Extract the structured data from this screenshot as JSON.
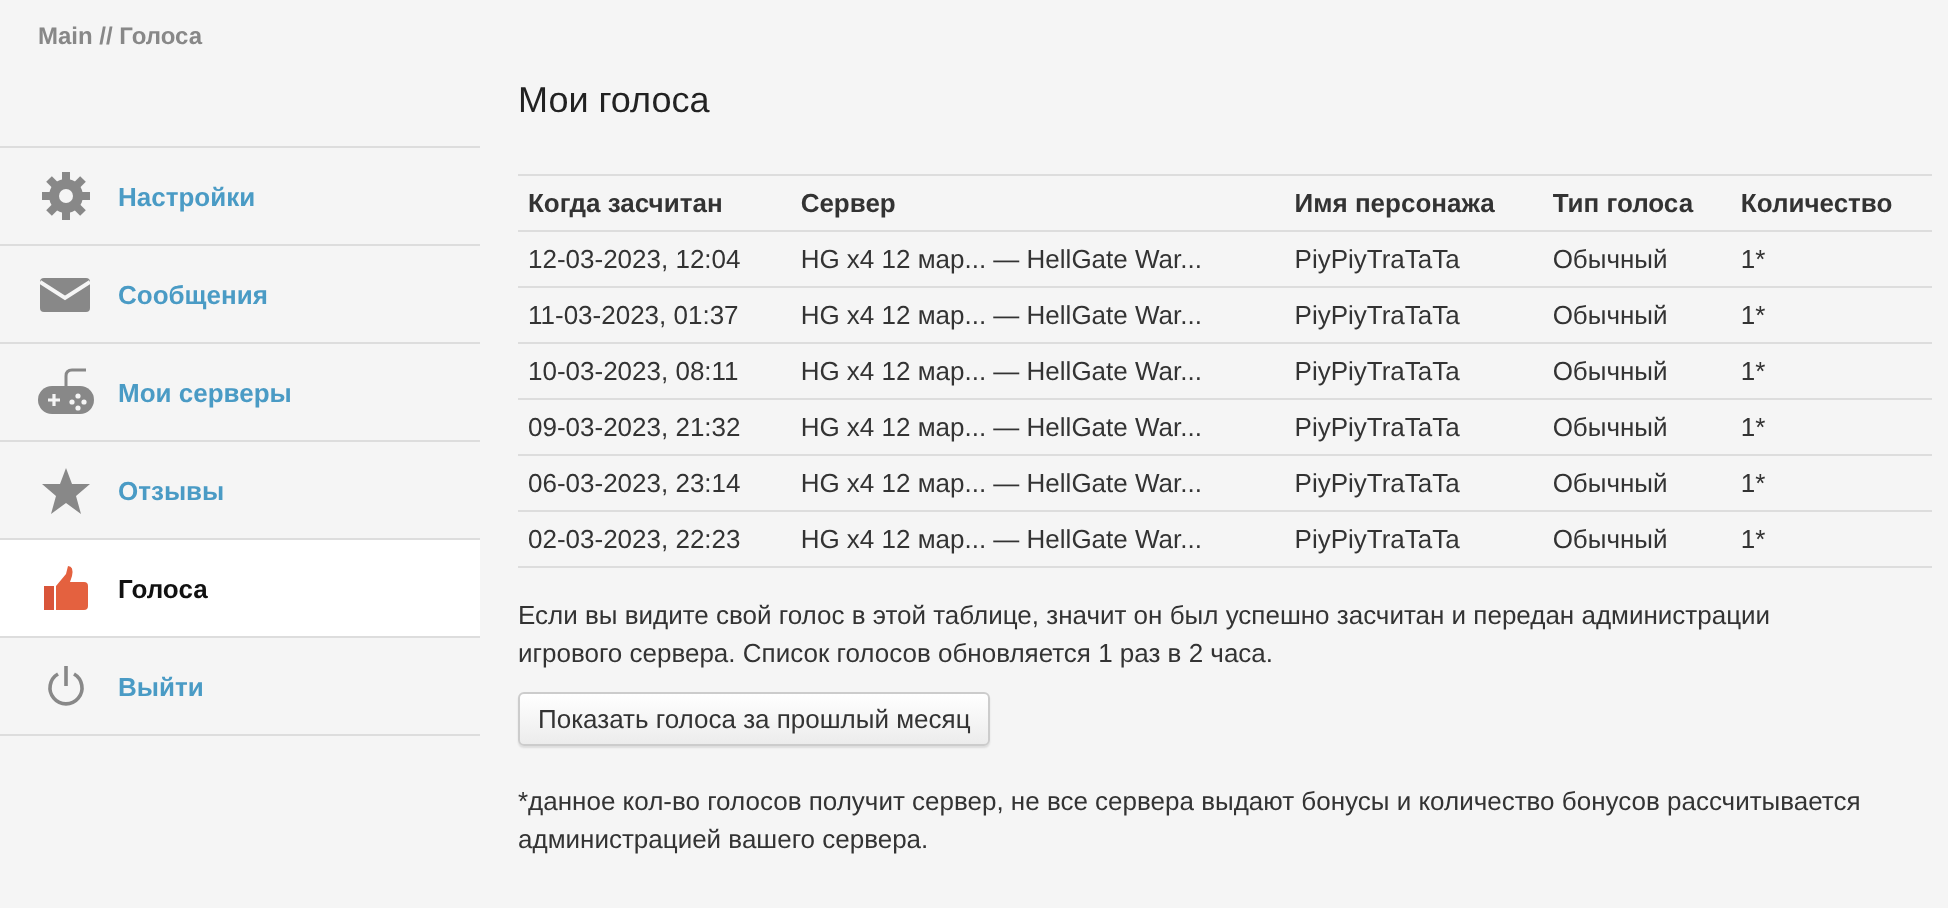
{
  "breadcrumb": "Main // Голоса",
  "sidebar": {
    "items": [
      {
        "label": "Настройки",
        "selected": false
      },
      {
        "label": "Сообщения",
        "selected": false
      },
      {
        "label": "Мои серверы",
        "selected": false
      },
      {
        "label": "Отзывы",
        "selected": false
      },
      {
        "label": "Голоса",
        "selected": true
      },
      {
        "label": "Выйти",
        "selected": false
      }
    ]
  },
  "title": "Мои голоса",
  "table": {
    "columns": [
      "Когда засчитан",
      "Сервер",
      "Имя персонажа",
      "Тип голоса",
      "Количество"
    ],
    "rows": [
      [
        "12-03-2023, 12:04",
        "HG x4 12 мар... — HellGate War...",
        "PiyPiyTraTaTa",
        "Обычный",
        "1*"
      ],
      [
        "11-03-2023, 01:37",
        "HG x4 12 мар... — HellGate War...",
        "PiyPiyTraTaTa",
        "Обычный",
        "1*"
      ],
      [
        "10-03-2023, 08:11",
        "HG x4 12 мар... — HellGate War...",
        "PiyPiyTraTaTa",
        "Обычный",
        "1*"
      ],
      [
        "09-03-2023, 21:32",
        "HG x4 12 мар... — HellGate War...",
        "PiyPiyTraTaTa",
        "Обычный",
        "1*"
      ],
      [
        "06-03-2023, 23:14",
        "HG x4 12 мар... — HellGate War...",
        "PiyPiyTraTaTa",
        "Обычный",
        "1*"
      ],
      [
        "02-03-2023, 22:23",
        "HG x4 12 мар... — HellGate War...",
        "PiyPiyTraTaTa",
        "Обычный",
        "1*"
      ]
    ]
  },
  "info": "Если вы видите свой голос в этой таблице, значит он был успешно засчитан и передан администрации игрового сервера. Список голосов обновляется 1 раз в 2 часа.",
  "button": "Показать голоса за прошлый месяц",
  "footnote": "*данное кол-во голосов получит сервер, не все сервера выдают бонусы и количество бонусов рассчитывается администрацией вашего сервера."
}
